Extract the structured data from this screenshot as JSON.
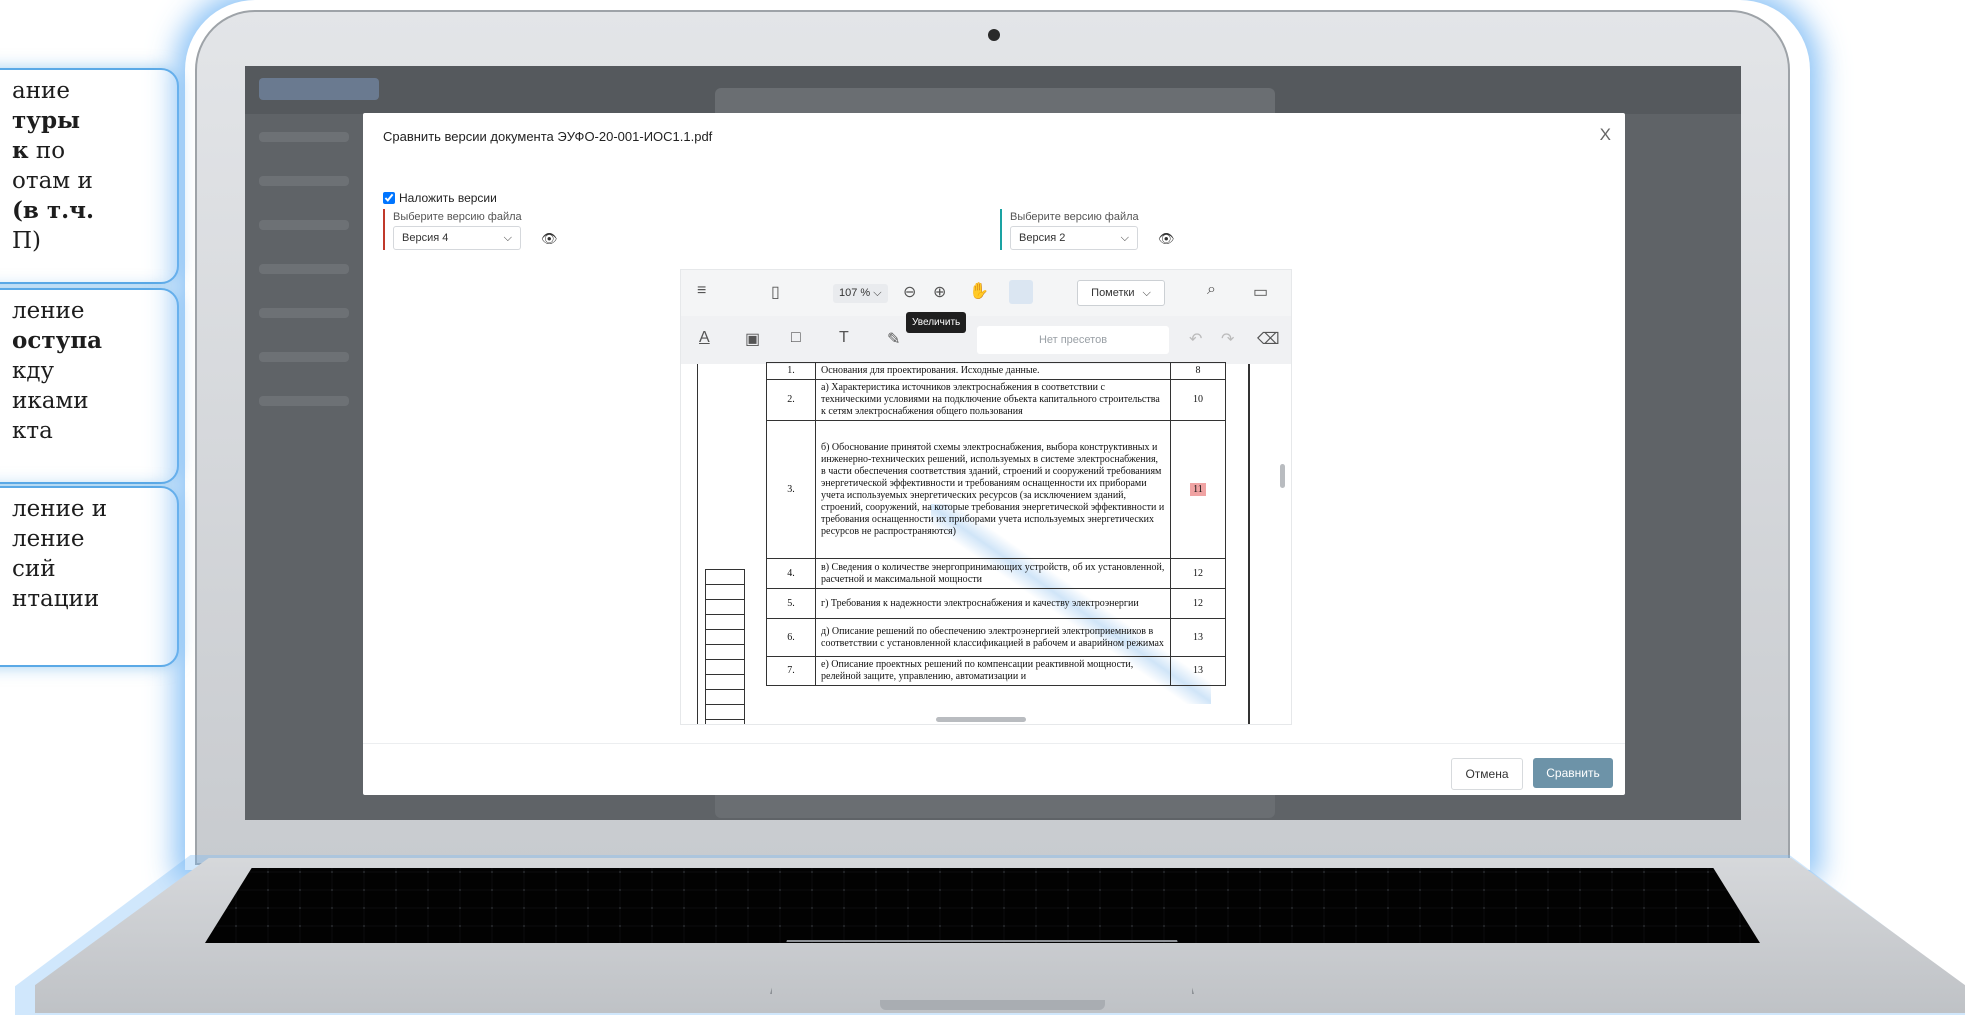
{
  "callouts": [
    {
      "pre": "ание",
      "bold": "туры",
      "bold2": "к",
      "text_after_bold2": " по",
      "l4": "отам и",
      "l5": " (в т.ч.",
      "l6": "П)"
    },
    {
      "l1": "ление",
      "bold": "оступа",
      "l3": "кду",
      "l4": "иками",
      "l5": "кта"
    },
    {
      "l1": "ление и",
      "l2": "ление",
      "l3": "сий",
      "l4": "нтации"
    }
  ],
  "modal": {
    "title": "Сравнить версии документа ЭУФО-20-001-ИОС1.1.pdf",
    "close": "X",
    "overlay_label": "Наложить версии",
    "left_version": {
      "label": "Выберите версию файла",
      "value": "Версия 4"
    },
    "right_version": {
      "label": "Выберите версию файла",
      "value": "Версия 2"
    },
    "cancel": "Отмена",
    "compare": "Сравнить"
  },
  "viewer": {
    "zoom": "107 %",
    "tooltip": "Увеличить",
    "marks_select": "Пометки",
    "presets": "Нет пресетов"
  },
  "toc": [
    {
      "num": "1.",
      "text": "Основания для проектирования. Исходные данные.",
      "page": "8"
    },
    {
      "num": "2.",
      "text": "а) Характеристика источников электроснабжения в соответствии с техническими условиями на подключение объекта капитального строительства к сетям электроснабжения общего пользования",
      "page": "10"
    },
    {
      "num": "3.",
      "text": "б) Обоснование принятой схемы электроснабжения, выбора конструктивных и инженерно-технических решений, используемых в системе электроснабжения, в части обеспечения соответствия зданий, строений и сооружений требованиям энергетической эффективности и требованиям оснащенности их приборами учета используемых энергетических ресурсов (за исключением зданий, строений, сооружений, на которые требования энергетической эффективности и требования оснащенности их приборами учета используемых энергетических ресурсов не распространяются)",
      "page": "11"
    },
    {
      "num": "4.",
      "text": "в) Сведения о количестве энергопринимающих устройств, об их установленной, расчетной и максимальной мощности",
      "page": "12"
    },
    {
      "num": "5.",
      "text": "г) Требования к надежности электроснабжения и качеству электроэнергии",
      "page": "12"
    },
    {
      "num": "6.",
      "text": "д) Описание решений по обеспечению электроэнергией электроприемников в соответствии с установленной классификацией в рабочем и аварийном режимах",
      "page": "13"
    },
    {
      "num": "7.",
      "text": "е) Описание проектных решений по компенсации реактивной мощности, релейной защите, управлению, автоматизации и",
      "page": "13"
    }
  ],
  "colors": {
    "accent": "#5aa9e6",
    "compare_button": "#6d93a8",
    "left_marker": "#c0392b",
    "right_marker": "#1aa3a3",
    "highlight": "#f0a3a3"
  }
}
